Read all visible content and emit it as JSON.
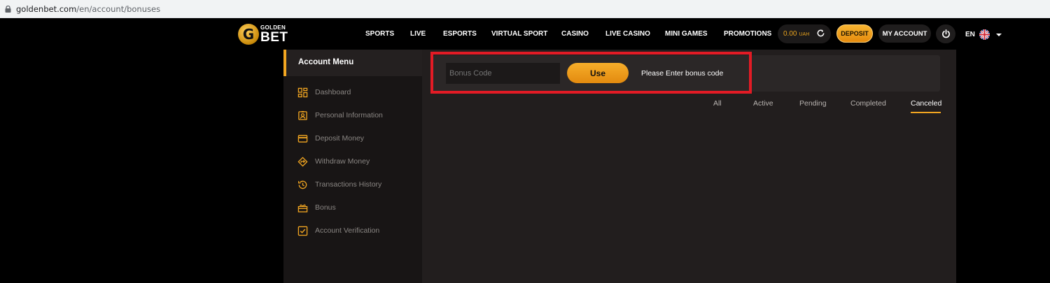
{
  "browser": {
    "url_domain": "goldenbet.com",
    "url_path": "/en/account/bonuses"
  },
  "header": {
    "logo": {
      "letter": "G",
      "word_small": "GOLDEN",
      "word_big": "BET"
    },
    "nav": [
      {
        "label": "SPORTS"
      },
      {
        "label": "LIVE"
      },
      {
        "label": "ESPORTS"
      },
      {
        "label": "VIRTUAL SPORT"
      },
      {
        "label": "CASINO"
      },
      {
        "label": "LIVE CASINO"
      },
      {
        "label": "MINI GAMES"
      },
      {
        "label": "PROMOTIONS"
      }
    ],
    "balance": {
      "amount": "0.00",
      "currency": "UAH"
    },
    "deposit_label": "DEPOSIT",
    "account_label": "MY ACCOUNT",
    "language": "EN"
  },
  "sidebar": {
    "title": "Account Menu",
    "items": [
      {
        "label": "Dashboard",
        "icon": "dashboard-icon"
      },
      {
        "label": "Personal Information",
        "icon": "id-card-icon"
      },
      {
        "label": "Deposit Money",
        "icon": "credit-card-icon"
      },
      {
        "label": "Withdraw Money",
        "icon": "withdraw-icon"
      },
      {
        "label": "Transactions History",
        "icon": "history-icon"
      },
      {
        "label": "Bonus",
        "icon": "gift-icon"
      },
      {
        "label": "Account Verification",
        "icon": "checkbox-icon"
      }
    ]
  },
  "bonus": {
    "placeholder": "Bonus Code",
    "use_label": "Use",
    "hint": "Please Enter bonus code"
  },
  "tabs": [
    {
      "label": "All"
    },
    {
      "label": "Active"
    },
    {
      "label": "Pending"
    },
    {
      "label": "Completed"
    },
    {
      "label": "Canceled",
      "active": true
    }
  ],
  "colors": {
    "accent": "#f2a621",
    "highlight": "#e21b25",
    "panel": "#221e1e",
    "sidebar": "#181515"
  }
}
